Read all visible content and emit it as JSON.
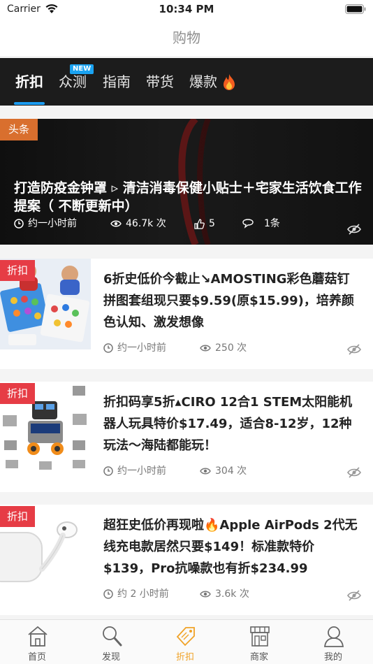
{
  "status": {
    "carrier": "Carrier",
    "time": "10:34 PM"
  },
  "nav": {
    "title": "购物"
  },
  "tabs": [
    {
      "label": "折扣",
      "active": true
    },
    {
      "label": "众测",
      "badge": "NEW"
    },
    {
      "label": "指南"
    },
    {
      "label": "带货"
    },
    {
      "label": "爆款",
      "icon": "fire-icon"
    }
  ],
  "headline": {
    "tag": "头条",
    "title": "打造防疫金钟罩 ▹ 清洁消毒保健小贴士＋宅家生活饮食工作提案（ 不断更新中）",
    "time": "约一小时前",
    "views": "46.7k 次",
    "likes": "5",
    "comments": "1条"
  },
  "cards": [
    {
      "tag": "折扣",
      "title": "6折史低价今截止↘AMOSTING彩色蘑菇钉拼图套组现只要$9.59(原$15.99)，培养颜色认知、激发想像",
      "time": "约一小时前",
      "views": "250 次"
    },
    {
      "tag": "折扣",
      "title": "折扣码享5折▴CIRO 12合1 STEM太阳能机器人玩具特价$17.49，适合8-12岁，12种玩法～海陆都能玩！",
      "time": "约一小时前",
      "views": "304 次"
    },
    {
      "tag": "折扣",
      "title": "超狂史低价再现啦🔥Apple AirPods 2代无线充电款居然只要$149！标准款特价$139，Pro抗噪款也有折$234.99",
      "time": "约 2 小时前",
      "views": "3.6k 次"
    }
  ],
  "bottom_nav": [
    {
      "label": "首页",
      "icon": "house-icon"
    },
    {
      "label": "发现",
      "icon": "magnifier-icon"
    },
    {
      "label": "折扣",
      "icon": "price-tag-icon",
      "active": true
    },
    {
      "label": "商家",
      "icon": "storefront-icon"
    },
    {
      "label": "我的",
      "icon": "user-icon"
    }
  ],
  "colors": {
    "accent_blue": "#1a9bf0",
    "discount_red": "#e63c45",
    "headline_orange": "#d96f2e",
    "active_orange": "#f0a227"
  }
}
